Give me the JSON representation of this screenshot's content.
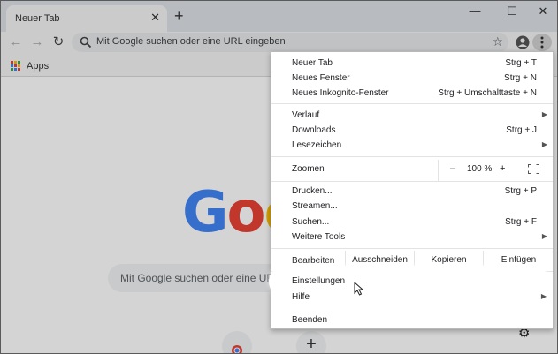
{
  "tab": {
    "title": "Neuer Tab",
    "close_glyph": "✕"
  },
  "new_tab_glyph": "+",
  "window_controls": {
    "minimize": "—",
    "maximize": "☐",
    "close": "✕"
  },
  "toolbar": {
    "back": "←",
    "forward": "→",
    "reload": "↻",
    "omnibox_placeholder": "Mit Google suchen oder eine URL eingeben",
    "bookmark_star": "☆"
  },
  "bookmarks": {
    "apps_label": "Apps"
  },
  "page": {
    "logo_letters": [
      "G",
      "o",
      "o"
    ],
    "logo_colors": [
      "#4285f4",
      "#ea4335",
      "#fbbc05"
    ],
    "search_placeholder": "Mit Google suchen oder eine URL ei",
    "add_shortcut": "+"
  },
  "menu": {
    "items": [
      {
        "label": "Neuer Tab",
        "shortcut": "Strg + T"
      },
      {
        "label": "Neues Fenster",
        "shortcut": "Strg + N"
      },
      {
        "label": "Neues Inkognito-Fenster",
        "shortcut": "Strg + Umschalttaste + N"
      },
      {
        "label": "Verlauf",
        "shortcut": ""
      },
      {
        "label": "Downloads",
        "shortcut": "Strg + J"
      },
      {
        "label": "Lesezeichen",
        "shortcut": ""
      },
      {
        "label": "Drucken...",
        "shortcut": "Strg + P"
      },
      {
        "label": "Streamen...",
        "shortcut": ""
      },
      {
        "label": "Suchen...",
        "shortcut": "Strg + F"
      },
      {
        "label": "Weitere Tools",
        "shortcut": ""
      },
      {
        "label": "Einstellungen",
        "shortcut": ""
      },
      {
        "label": "Hilfe",
        "shortcut": ""
      },
      {
        "label": "Beenden",
        "shortcut": ""
      }
    ],
    "zoom": {
      "label": "Zoomen",
      "minus": "–",
      "value": "100 %",
      "plus": "+"
    },
    "edit": {
      "label": "Bearbeiten",
      "cut": "Ausschneiden",
      "copy": "Kopieren",
      "paste": "Einfügen"
    },
    "submenu_arrow": "▶"
  },
  "colors": {
    "apps_grid": [
      "#ea4335",
      "#fbbc05",
      "#34a853",
      "#4285f4",
      "#ea4335",
      "#fbbc05",
      "#34a853",
      "#4285f4",
      "#ea4335"
    ]
  }
}
